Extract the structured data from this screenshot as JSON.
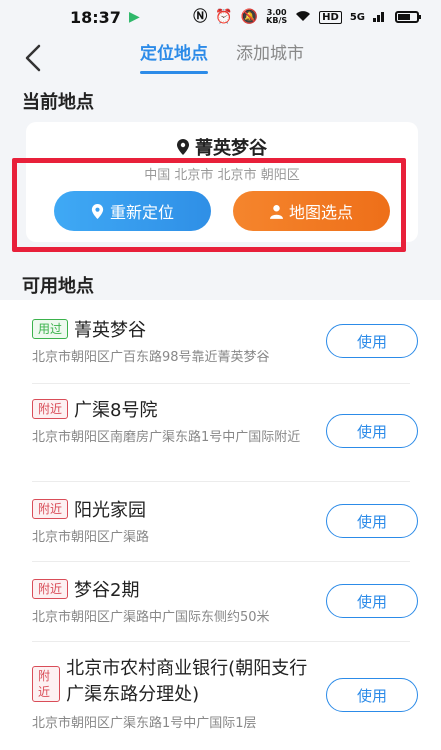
{
  "status_bar": {
    "time": "18:37",
    "speed": "3.00",
    "speed_unit": "KB/S",
    "hd": "HD",
    "network": "5G"
  },
  "nav": {
    "tab_active": "定位地点",
    "tab_inactive": "添加城市"
  },
  "current": {
    "section_title": "当前地点",
    "name": "菁英梦谷",
    "address": "中国 北京市 北京市 朝阳区",
    "relocate_label": "重新定位",
    "map_pick_label": "地图选点"
  },
  "available": {
    "section_title": "可用地点",
    "use_label": "使用",
    "items": [
      {
        "tag": "用过",
        "title": "菁英梦谷",
        "address": "北京市朝阳区广百东路98号靠近菁英梦谷"
      },
      {
        "tag": "附近",
        "title": "广渠8号院",
        "address": "北京市朝阳区南磨房广渠东路1号中广国际附近"
      },
      {
        "tag": "附近",
        "title": "阳光家园",
        "address": "北京市朝阳区广渠路"
      },
      {
        "tag": "附近",
        "title": "梦谷2期",
        "address": "北京市朝阳区广渠路中广国际东侧约50米"
      },
      {
        "tag": "附近",
        "title": "北京市农村商业银行(朝阳支行广渠东路分理处)",
        "address": "北京市朝阳区广渠东路1号中广国际1层"
      }
    ]
  },
  "colors": {
    "accent": "#2c8be8",
    "relocate": "#3fa9f5",
    "map_pick": "#f5852d",
    "highlight": "#e8203a",
    "tag_used": "#3bb24c",
    "tag_near": "#d94d58"
  }
}
